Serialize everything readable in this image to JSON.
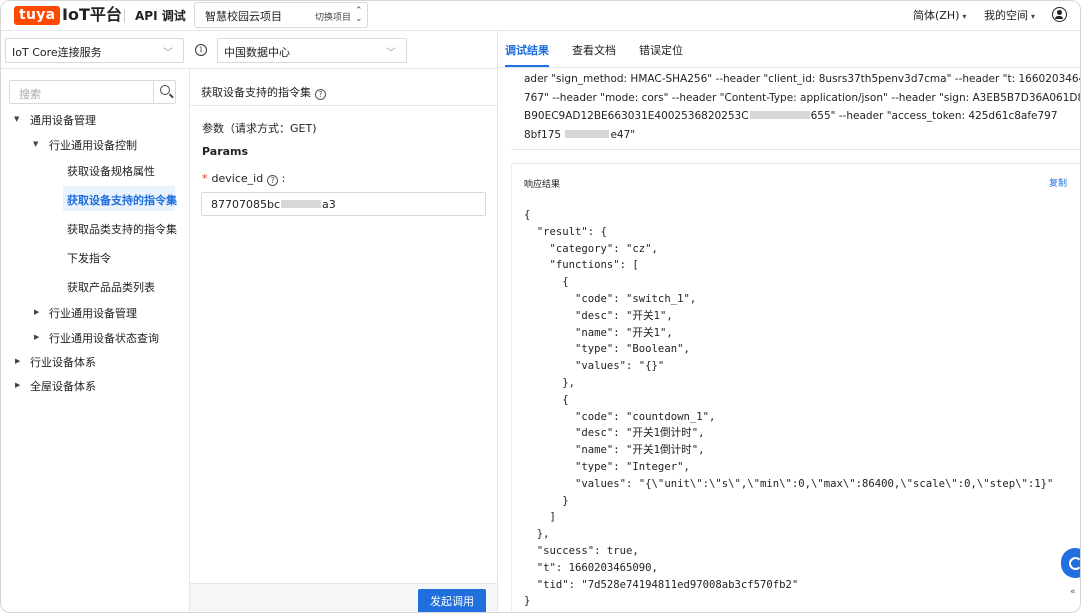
{
  "topbar": {
    "logo_text": "tuya",
    "brand": "IoT平台",
    "api_title": "API 调试",
    "project_name": "智慧校园云项目",
    "switch_project": "切换项目",
    "language": "简体(ZH)",
    "my_space": "我的空间"
  },
  "selectors": {
    "service": "IoT Core连接服务",
    "datacenter": "中国数据中心"
  },
  "tabs": [
    "调试结果",
    "查看文档",
    "错误定位"
  ],
  "sidebar": {
    "search_placeholder": "搜索",
    "tree": {
      "general": "通用设备管理",
      "industry_control": "行业通用设备控制",
      "leaves": [
        "获取设备规格属性",
        "获取设备支持的指令集",
        "获取品类支持的指令集",
        "下发指令",
        "获取产品品类列表"
      ],
      "industry_mgmt": "行业通用设备管理",
      "industry_status": "行业通用设备状态查询",
      "industry_system": "行业设备体系",
      "home_system": "全屋设备体系"
    }
  },
  "middle": {
    "title": "获取设备支持的指令集",
    "param_header": "参数（请求方式：GET)",
    "params_label": "Params",
    "device_id_label": "device_id",
    "device_id_prefix": "87707085bc",
    "device_id_suffix": "a3",
    "send_button": "发起调用"
  },
  "request_lines": [
    "ader \"sign_method: HMAC-SHA256\" --header \"client_id: 8usrs37th5penv3d7cma\" --header \"t: 1660203464",
    "767\" --header \"mode: cors\" --header \"Content-Type: application/json\" --header \"sign: A3EB5B7D36A061D8",
    "B90EC9AD12BE663031E4002536820253C",
    "655\" --header \"access_token: 425d61c8afe797",
    "8bf175",
    "e47\""
  ],
  "response": {
    "header": "响应结果",
    "copy_label": "复制",
    "lines": [
      "{",
      "  \"result\": {",
      "    \"category\": \"cz\",",
      "    \"functions\": [",
      "      {",
      "        \"code\": \"switch_1\",",
      "        \"desc\": \"开关1\",",
      "        \"name\": \"开关1\",",
      "        \"type\": \"Boolean\",",
      "        \"values\": \"{}\"",
      "      },",
      "      {",
      "        \"code\": \"countdown_1\",",
      "        \"desc\": \"开关1倒计时\",",
      "        \"name\": \"开关1倒计时\",",
      "        \"type\": \"Integer\",",
      "        \"values\": \"{\\\"unit\\\":\\\"s\\\",\\\"min\\\":0,\\\"max\\\":86400,\\\"scale\\\":0,\\\"step\\\":1}\"",
      "      }",
      "    ]",
      "  },",
      "  \"success\": true,",
      "  \"t\": 1660203465090,",
      "  \"tid\": \"7d528e74194811ed97008ab3cf570fb2\"",
      "}"
    ]
  },
  "colors": {
    "brand": "#ff4800",
    "accent": "#1f6fde"
  }
}
